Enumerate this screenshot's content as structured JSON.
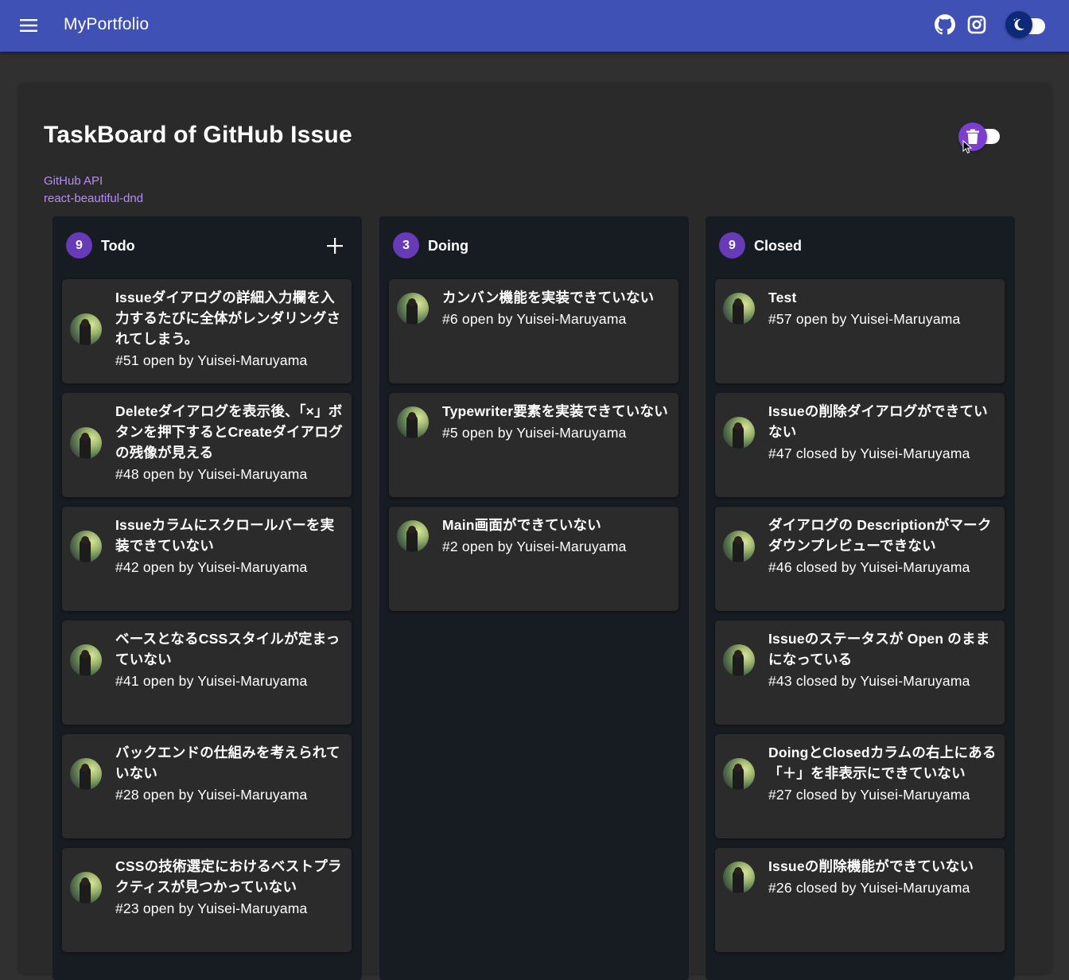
{
  "appbar": {
    "title": "MyPortfolio",
    "menu_icon": "hamburger-menu-icon",
    "github_icon": "github-icon",
    "instagram_icon": "instagram-icon",
    "theme_icon": "moon-icon",
    "color": "#3f51b5"
  },
  "page": {
    "title": "TaskBoard of GitHub Issue",
    "links": [
      "GitHub API",
      "react-beautiful-dnd"
    ],
    "delete_icon": "trash-icon",
    "accent": "#673ab7"
  },
  "columns": [
    {
      "name": "Todo",
      "count": "9",
      "cards": [
        {
          "title": "Issueダイアログの詳細入力欄を入力するたびに全体がレンダリングされてしまう。",
          "meta": "#51 open by Yuisei-Maruyama"
        },
        {
          "title": "Deleteダイアログを表示後、「×」ボタンを押下するとCreateダイアログの残像が見える",
          "meta": "#48 open by Yuisei-Maruyama"
        },
        {
          "title": "Issueカラムにスクロールバーを実装できていない",
          "meta": "#42 open by Yuisei-Maruyama"
        },
        {
          "title": "ベースとなるCSSスタイルが定まっていない",
          "meta": "#41 open by Yuisei-Maruyama"
        },
        {
          "title": "バックエンドの仕組みを考えられていない",
          "meta": "#28 open by Yuisei-Maruyama"
        },
        {
          "title": "CSSの技術選定におけるベストプラクティスが見つかっていない",
          "meta": "#23 open by Yuisei-Maruyama"
        }
      ]
    },
    {
      "name": "Doing",
      "count": "3",
      "cards": [
        {
          "title": "カンバン機能を実装できていない",
          "meta": "#6 open by Yuisei-Maruyama"
        },
        {
          "title": "Typewriter要素を実装できていない",
          "meta": "#5 open by Yuisei-Maruyama"
        },
        {
          "title": "Main画面ができていない",
          "meta": "#2 open by Yuisei-Maruyama"
        }
      ]
    },
    {
      "name": "Closed",
      "count": "9",
      "cards": [
        {
          "title": "Test",
          "meta": "#57 open by Yuisei-Maruyama"
        },
        {
          "title": "Issueの削除ダイアログができていない",
          "meta": "#47 closed by Yuisei-Maruyama"
        },
        {
          "title": "ダイアログの Descriptionがマークダウンプレビューできない",
          "meta": "#46 closed by Yuisei-Maruyama"
        },
        {
          "title": "Issueのステータスが Open のままになっている",
          "meta": "#43 closed by Yuisei-Maruyama"
        },
        {
          "title": "DoingとClosedカラムの右上にある「＋」を非表示にできていない",
          "meta": "#27 closed by Yuisei-Maruyama"
        },
        {
          "title": "Issueの削除機能ができていない",
          "meta": "#26 closed by Yuisei-Maruyama"
        }
      ]
    }
  ]
}
